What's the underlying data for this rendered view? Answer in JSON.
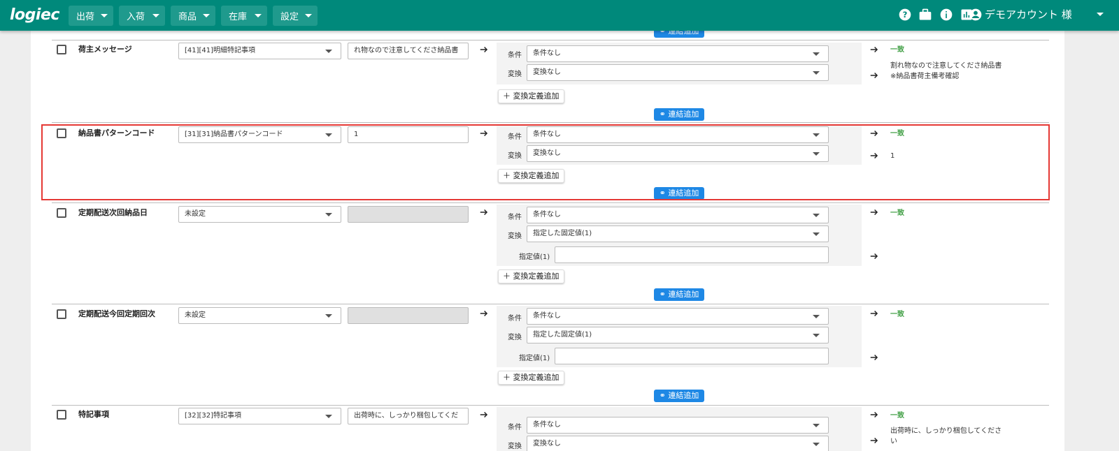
{
  "app": {
    "logo": "logiec"
  },
  "nav": [
    {
      "label": "出荷"
    },
    {
      "label": "入荷"
    },
    {
      "label": "商品"
    },
    {
      "label": "在庫"
    },
    {
      "label": "設定"
    }
  ],
  "account": {
    "name": "デモアカウント 様"
  },
  "icons": {
    "help": "help-circle-icon",
    "briefcase": "briefcase-icon",
    "info": "info-icon",
    "chart": "bar-chart-icon",
    "account": "account-circle-icon",
    "arrow": "arrow-right-icon",
    "link": "link-icon"
  },
  "labels": {
    "condition": "条件",
    "transform": "変換",
    "fixed_value": "指定値(1)",
    "add_def": "＋ 変換定義追加",
    "link_add": "連結追加",
    "match": "一致",
    "none_condition": "条件なし",
    "none_transform": "変換なし",
    "fixed_transform": "指定した固定値(1)"
  },
  "colors": {
    "header": "#00897b",
    "link_button": "#1e88e5",
    "match_text": "#43a047",
    "highlight": "#e53935"
  },
  "rows": [
    {
      "name": "荷主メッセージ",
      "source": "[41][41]明細特記事項",
      "sample": "れ物なので注意してくださ納品書",
      "result": "割れ物なので注意してくださ納品書\n※納品書荷主備考確認"
    },
    {
      "name": "納品書パターンコード",
      "source": "[31][31]納品書パターンコード",
      "sample": "1",
      "result": "1"
    },
    {
      "name": "定期配送次回納品日",
      "source": "未設定",
      "sample": "",
      "result": ""
    },
    {
      "name": "定期配送今回定期回次",
      "source": "未設定",
      "sample": "",
      "result": ""
    },
    {
      "name": "特記事項",
      "source": "[32][32]特記事項",
      "sample": "出荷時に、しっかり梱包してくだ",
      "result": "出荷時に、しっかり梱包してくださ\nい"
    }
  ]
}
